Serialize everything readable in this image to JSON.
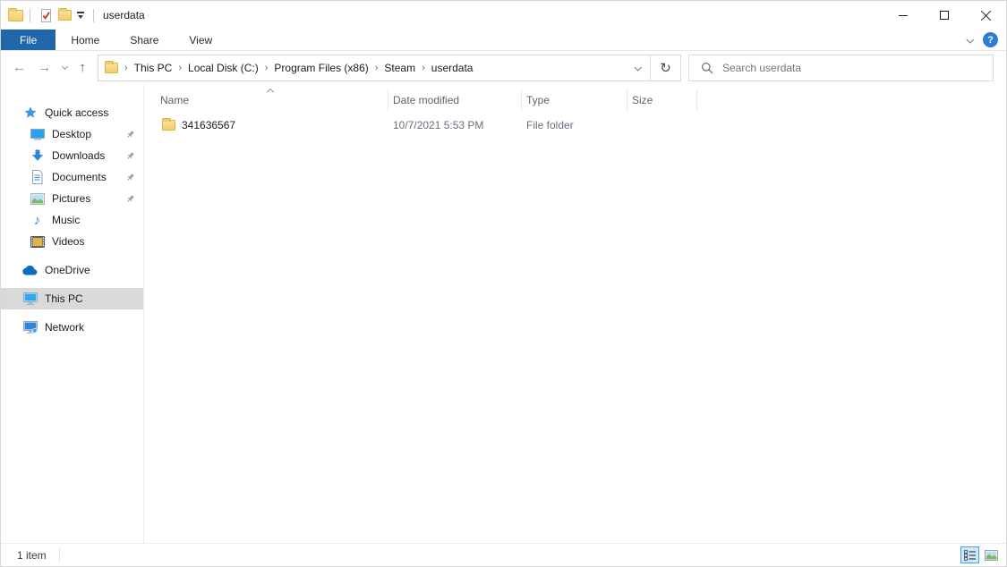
{
  "titlebar": {
    "title": "userdata"
  },
  "ribbon": {
    "tabs": [
      {
        "label": "File",
        "active": true
      },
      {
        "label": "Home",
        "active": false
      },
      {
        "label": "Share",
        "active": false
      },
      {
        "label": "View",
        "active": false
      }
    ]
  },
  "navigation": {
    "breadcrumb": [
      "This PC",
      "Local Disk (C:)",
      "Program Files (x86)",
      "Steam",
      "userdata"
    ],
    "search_placeholder": "Search userdata"
  },
  "sidebar": {
    "items": [
      {
        "label": "Quick access",
        "icon": "star-icon"
      },
      {
        "label": "Desktop",
        "icon": "desktop-icon",
        "pinned": true
      },
      {
        "label": "Downloads",
        "icon": "download-arrow-icon",
        "pinned": true
      },
      {
        "label": "Documents",
        "icon": "document-icon",
        "pinned": true
      },
      {
        "label": "Pictures",
        "icon": "picture-icon",
        "pinned": true
      },
      {
        "label": "Music",
        "icon": "music-note-icon"
      },
      {
        "label": "Videos",
        "icon": "film-icon"
      },
      {
        "label": "OneDrive",
        "icon": "onedrive-cloud-icon"
      },
      {
        "label": "This PC",
        "icon": "computer-icon",
        "selected": true
      },
      {
        "label": "Network",
        "icon": "network-icon"
      }
    ]
  },
  "file_list": {
    "columns": [
      "Name",
      "Date modified",
      "Type",
      "Size"
    ],
    "sort": {
      "column": "Name",
      "direction": "ascending"
    },
    "rows": [
      {
        "name": "341636567",
        "date_modified": "10/7/2021 5:53 PM",
        "type": "File folder",
        "size": ""
      }
    ]
  },
  "statusbar": {
    "item_count": "1 item"
  },
  "icons": {
    "back": "←",
    "forward": "→",
    "up": "↑",
    "refresh": "↻",
    "breadcrumb_separator": "›",
    "help": "?",
    "music_note": "♪"
  },
  "colors": {
    "file_tab_blue": "#1f66ab",
    "help_blue": "#2d7dd2",
    "folder_yellow": "#f2cc6b",
    "sidebar_selection": "#d9d9d9",
    "active_view_button_bg": "#cde8f7"
  }
}
